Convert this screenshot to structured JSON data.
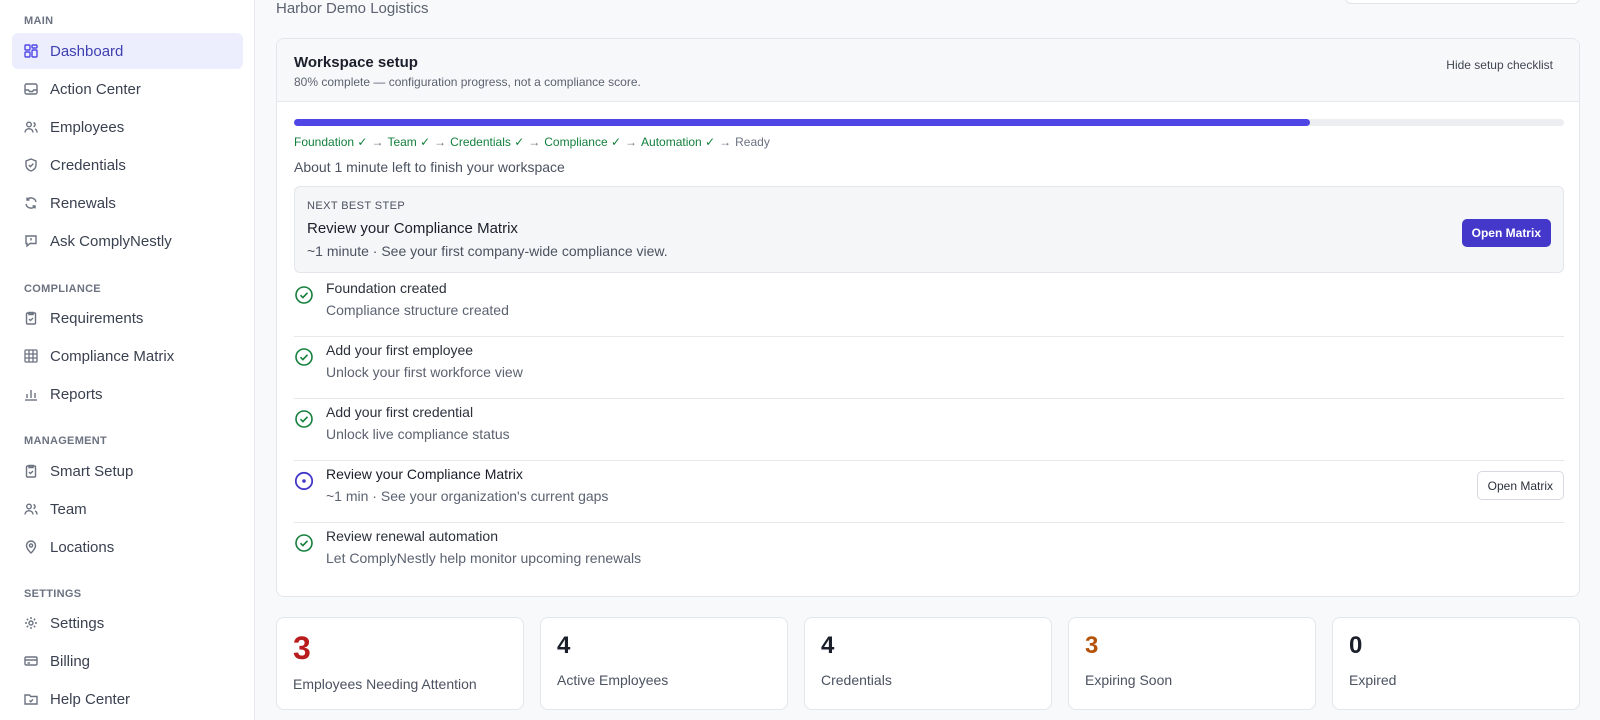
{
  "org_name": "Harbor Demo Logistics",
  "sidebar": {
    "sections": [
      {
        "label": "MAIN",
        "items": [
          {
            "label": "Dashboard",
            "icon": "dashboard-icon",
            "active": true
          },
          {
            "label": "Action Center",
            "icon": "inbox-icon"
          },
          {
            "label": "Employees",
            "icon": "users-icon"
          },
          {
            "label": "Credentials",
            "icon": "shield-check-icon"
          },
          {
            "label": "Renewals",
            "icon": "refresh-icon"
          },
          {
            "label": "Ask ComplyNestly",
            "icon": "chat-icon"
          }
        ]
      },
      {
        "label": "COMPLIANCE",
        "items": [
          {
            "label": "Requirements",
            "icon": "clipboard-check-icon"
          },
          {
            "label": "Compliance Matrix",
            "icon": "grid-icon"
          },
          {
            "label": "Reports",
            "icon": "bar-chart-icon"
          }
        ]
      },
      {
        "label": "MANAGEMENT",
        "items": [
          {
            "label": "Smart Setup",
            "icon": "clipboard-check-icon"
          },
          {
            "label": "Team",
            "icon": "users-icon"
          },
          {
            "label": "Locations",
            "icon": "map-pin-icon"
          }
        ]
      },
      {
        "label": "SETTINGS",
        "items": [
          {
            "label": "Settings",
            "icon": "gear-icon"
          },
          {
            "label": "Billing",
            "icon": "credit-card-icon"
          },
          {
            "label": "Help Center",
            "icon": "help-folder-icon"
          }
        ]
      }
    ]
  },
  "setup": {
    "title": "Workspace setup",
    "subtitle": "80% complete — configuration progress, not a compliance score.",
    "hide_label": "Hide setup checklist",
    "progress": 0.8,
    "steps": [
      {
        "label": "Foundation ✓",
        "done": true
      },
      {
        "label": "Team ✓",
        "done": true
      },
      {
        "label": "Credentials ✓",
        "done": true
      },
      {
        "label": "Compliance ✓",
        "done": true
      },
      {
        "label": "Automation ✓",
        "done": true
      },
      {
        "label": "Ready",
        "done": false
      }
    ],
    "step_separator": "→",
    "time_left": "About 1 minute left to finish your workspace",
    "next_step": {
      "label": "NEXT BEST STEP",
      "title": "Review your Compliance Matrix",
      "desc": "~1 minute · See your first company-wide compliance view.",
      "button": "Open Matrix"
    },
    "checklist": [
      {
        "title": "Foundation created",
        "desc": "Compliance structure created",
        "status": "done"
      },
      {
        "title": "Add your first employee",
        "desc": "Unlock your first workforce view",
        "status": "done"
      },
      {
        "title": "Add your first credential",
        "desc": "Unlock live compliance status",
        "status": "done"
      },
      {
        "title": "Review your Compliance Matrix",
        "desc": "~1 min · See your organization's current gaps",
        "status": "current",
        "button": "Open Matrix"
      },
      {
        "title": "Review renewal automation",
        "desc": "Let ComplyNestly help monitor upcoming renewals",
        "status": "done"
      }
    ]
  },
  "stats": [
    {
      "value": "3",
      "label": "Employees Needing Attention",
      "color": "#b91c1c"
    },
    {
      "value": "4",
      "label": "Active Employees",
      "color": "#1a1f2b"
    },
    {
      "value": "4",
      "label": "Credentials",
      "color": "#1a1f2b"
    },
    {
      "value": "3",
      "label": "Expiring Soon",
      "color": "#b45309"
    },
    {
      "value": "0",
      "label": "Expired",
      "color": "#1a1f2b"
    }
  ],
  "colors": {
    "accent": "#4f46e5",
    "success": "#15803d",
    "danger": "#b91c1c",
    "warning": "#b45309"
  }
}
